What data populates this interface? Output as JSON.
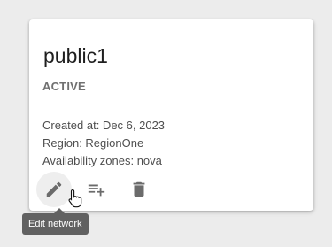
{
  "card": {
    "title": "public1",
    "status": "ACTIVE",
    "details": {
      "created": "Created at: Dec 6, 2023",
      "region": "Region: RegionOne",
      "zones": "Availability zones: nova"
    },
    "actions": [
      {
        "icon": "pencil-icon",
        "label": "Edit network"
      },
      {
        "icon": "playlist-add-icon",
        "label": "Add subnet"
      },
      {
        "icon": "trash-icon",
        "label": "Delete network"
      }
    ]
  },
  "tooltip": {
    "text": "Edit network"
  },
  "colors": {
    "background": "#ececec",
    "card": "#ffffff",
    "icon": "#6b6b6b",
    "tooltip": "#616161"
  }
}
